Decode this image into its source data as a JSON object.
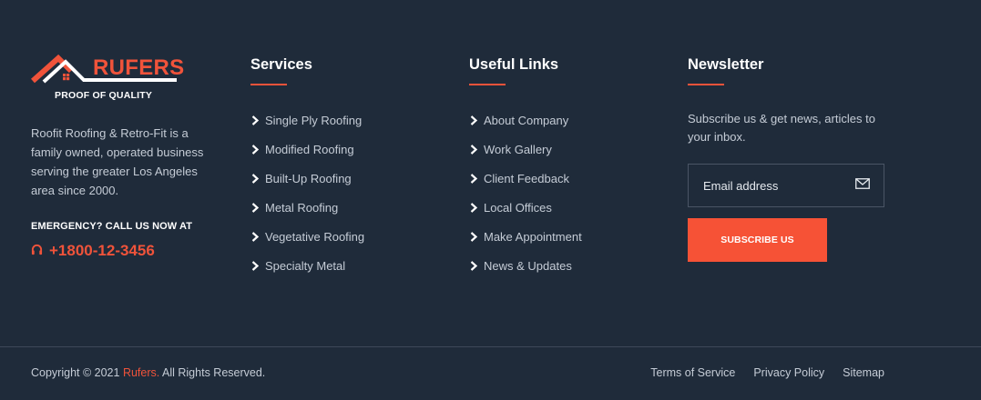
{
  "brand": {
    "name": "RUFERS",
    "tagline": "PROOF OF QUALITY",
    "about": "Roofit Roofing & Retro-Fit is a family owned, operated business serving the greater Los Angeles area since 2000.",
    "emergency_label": "EMERGENCY? CALL US NOW AT",
    "phone": "+1800-12-3456",
    "phone_icon": "headphones-icon",
    "accent_color": "#f0533a"
  },
  "services": {
    "heading": "Services",
    "items": [
      "Single Ply Roofing",
      "Modified Roofing",
      "Built-Up Roofing",
      "Metal Roofing",
      "Vegetative Roofing",
      "Specialty Metal"
    ]
  },
  "useful_links": {
    "heading": "Useful Links",
    "items": [
      "About Company",
      "Work Gallery",
      "Client Feedback",
      "Local Offices",
      "Make Appointment",
      "News & Updates"
    ]
  },
  "newsletter": {
    "heading": "Newsletter",
    "text": "Subscribe us & get news, articles to your inbox.",
    "email_placeholder": "Email address",
    "email_value": "",
    "email_icon": "envelope-icon",
    "button_label": "SUBSCRIBE US",
    "button_color": "#f65236"
  },
  "bottom": {
    "copyright_prefix": "Copyright © 2021 ",
    "copyright_brand": "Rufers.",
    "copyright_suffix": " All Rights Reserved.",
    "links": [
      "Terms of Service",
      "Privacy Policy",
      "Sitemap"
    ]
  },
  "colors": {
    "background": "#1f2b3a",
    "text": "#c5ccd6",
    "heading": "#ffffff"
  }
}
